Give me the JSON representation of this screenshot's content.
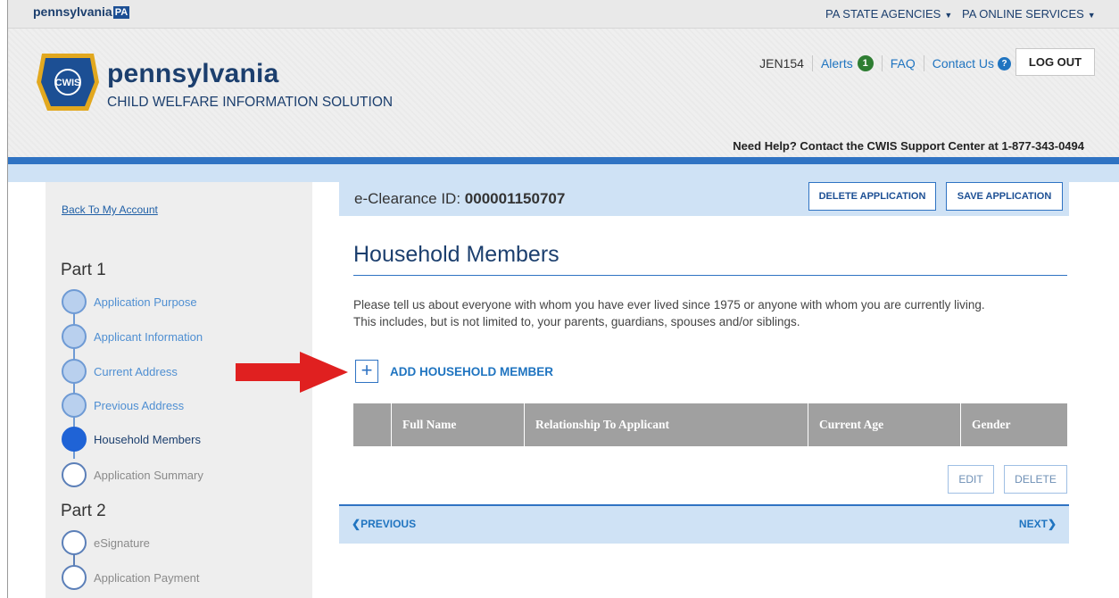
{
  "topbar": {
    "brand": "pennsylvania",
    "brand_box": "PA",
    "agencies": "PA STATE AGENCIES",
    "services": "PA ONLINE SERVICES"
  },
  "header": {
    "logo_title": "pennsylvania",
    "logo_subtitle": "CHILD WELFARE INFORMATION SOLUTION",
    "logo_badge": "CWIS",
    "user_id": "JEN154",
    "alerts_label": "Alerts",
    "alerts_count": "1",
    "faq": "FAQ",
    "contact": "Contact Us",
    "logout": "LOG OUT",
    "help": "Need Help? Contact the CWIS Support Center at 1-877-343-0494"
  },
  "sidebar": {
    "back_link": "Back To My Account",
    "part1": "Part 1",
    "part2": "Part 2",
    "part1_steps": [
      {
        "label": "Application Purpose",
        "state": "completed"
      },
      {
        "label": "Applicant Information",
        "state": "completed"
      },
      {
        "label": "Current Address",
        "state": "completed"
      },
      {
        "label": "Previous Address",
        "state": "completed"
      },
      {
        "label": "Household Members",
        "state": "active"
      },
      {
        "label": "Application Summary",
        "state": "future"
      }
    ],
    "part2_steps": [
      {
        "label": "eSignature",
        "state": "future"
      },
      {
        "label": "Application Payment",
        "state": "future"
      }
    ]
  },
  "main": {
    "clearance_label": "e-Clearance ID:",
    "clearance_id": "000001150707",
    "delete_app": "DELETE APPLICATION",
    "save_app": "SAVE APPLICATION",
    "title": "Household Members",
    "intro_line1": "Please tell us about everyone with whom you have ever lived since 1975 or anyone with whom you are currently living.",
    "intro_line2": "This includes, but is not limited to, your parents, guardians, spouses and/or siblings.",
    "add_plus": "+",
    "add_member": "ADD HOUSEHOLD MEMBER",
    "table": {
      "columns": [
        "",
        "Full Name",
        "Relationship To Applicant",
        "Current Age",
        "Gender"
      ]
    },
    "edit": "EDIT",
    "delete": "DELETE",
    "previous": "PREVIOUS",
    "next": "NEXT"
  },
  "colors": {
    "brand_navy": "#1c3f6e",
    "link_blue": "#1f74c0",
    "band_blue": "#cfe2f5",
    "arrow_red": "#e02020",
    "alert_green": "#2e7d32"
  }
}
